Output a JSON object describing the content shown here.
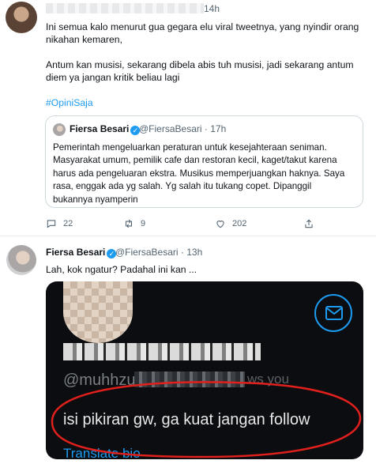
{
  "tweet1": {
    "time": "14h",
    "lines": [
      "Ini semua kalo menurut gua gegara elu viral tweetnya, yang nyindir orang",
      "nikahan kemaren,",
      "Antum kan musisi, sekarang dibela abis tuh musisi, jadi sekarang antum",
      "diem ya jangan kritik beliau lagi"
    ],
    "hashtag": "#OpiniSaja",
    "quote": {
      "name": "Fiersa Besari",
      "handle": "@FiersaBesari",
      "time": "17h",
      "lines": [
        "Pemerintah mengeluarkan peraturan untuk kesejahteraan seniman.",
        "Masyarakat umum, pemilik cafe dan restoran kecil, kaget/takut karena",
        "harus ada pengeluaran ekstra. Musikus memperjuangkan haknya. Saya",
        "rasa, enggak ada yg salah. Yg salah itu tukang copet. Dipanggil",
        "bukannya nyamperin"
      ]
    },
    "actions": {
      "replies": "22",
      "retweets": "9",
      "likes": "202"
    }
  },
  "tweet2": {
    "name": "Fiersa Besari",
    "handle": "@FiersaBesari",
    "time": "13h",
    "text": "Lah, kok ngatur? Padahal ini kan ...",
    "media": {
      "handle_prefix": "@muhhzuk",
      "follows_text": "ws you",
      "bio": "isi pikiran gw, ga kuat jangan follow",
      "translate": "Translate bio"
    }
  },
  "colors": {
    "link": "#1d9bf0",
    "muted": "#536471",
    "annotation": "#e0201c"
  },
  "icons": [
    "reply-icon",
    "retweet-icon",
    "like-icon",
    "share-icon",
    "mail-icon",
    "verified-icon"
  ]
}
